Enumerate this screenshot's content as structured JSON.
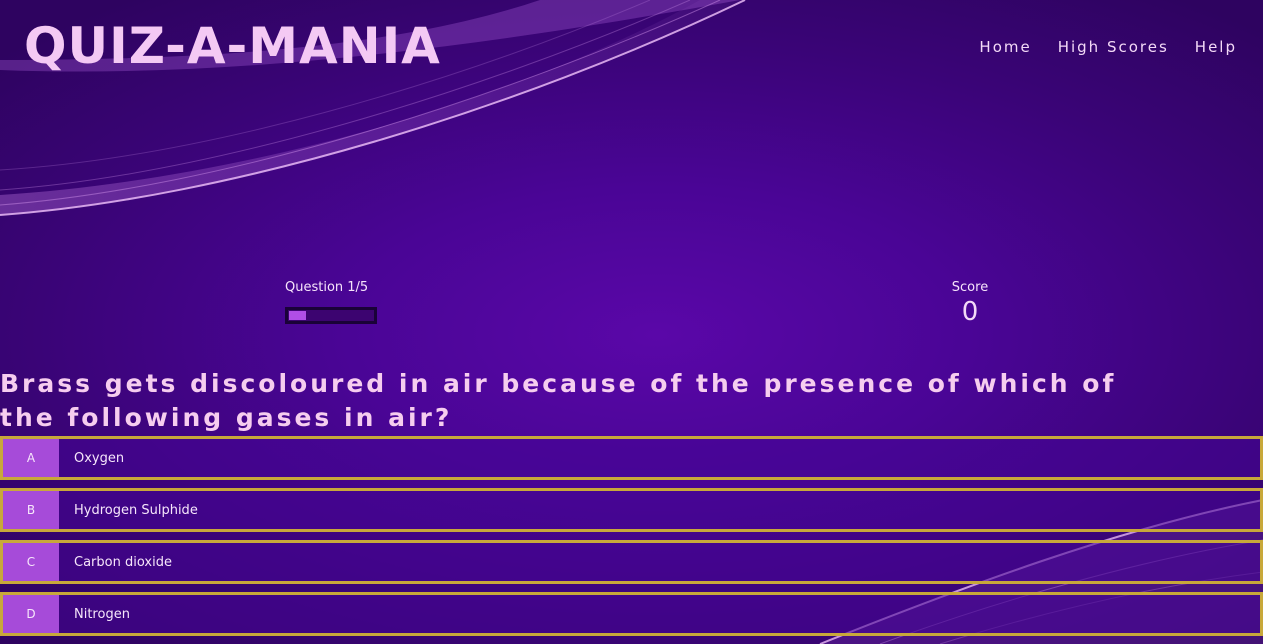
{
  "header": {
    "logo": "QUIZ-A-MANIA",
    "nav": [
      {
        "label": "Home"
      },
      {
        "label": "High Scores"
      },
      {
        "label": "Help"
      }
    ]
  },
  "hud": {
    "question_label": "Question 1/5",
    "progress_fraction": 0.2,
    "score_label": "Score",
    "score_value": "0"
  },
  "question": {
    "text": "Brass gets discoloured in air because of the presence of which of the following gases in air?"
  },
  "choices": [
    {
      "prefix": "A",
      "text": "Oxygen"
    },
    {
      "prefix": "B",
      "text": "Hydrogen Sulphide"
    },
    {
      "prefix": "C",
      "text": "Carbon dioxide"
    },
    {
      "prefix": "D",
      "text": "Nitrogen"
    }
  ],
  "colors": {
    "background": "#4a0596",
    "accent": "#a64bd9",
    "choice_border": "#c8a83a",
    "text": "#f3d3f6"
  }
}
